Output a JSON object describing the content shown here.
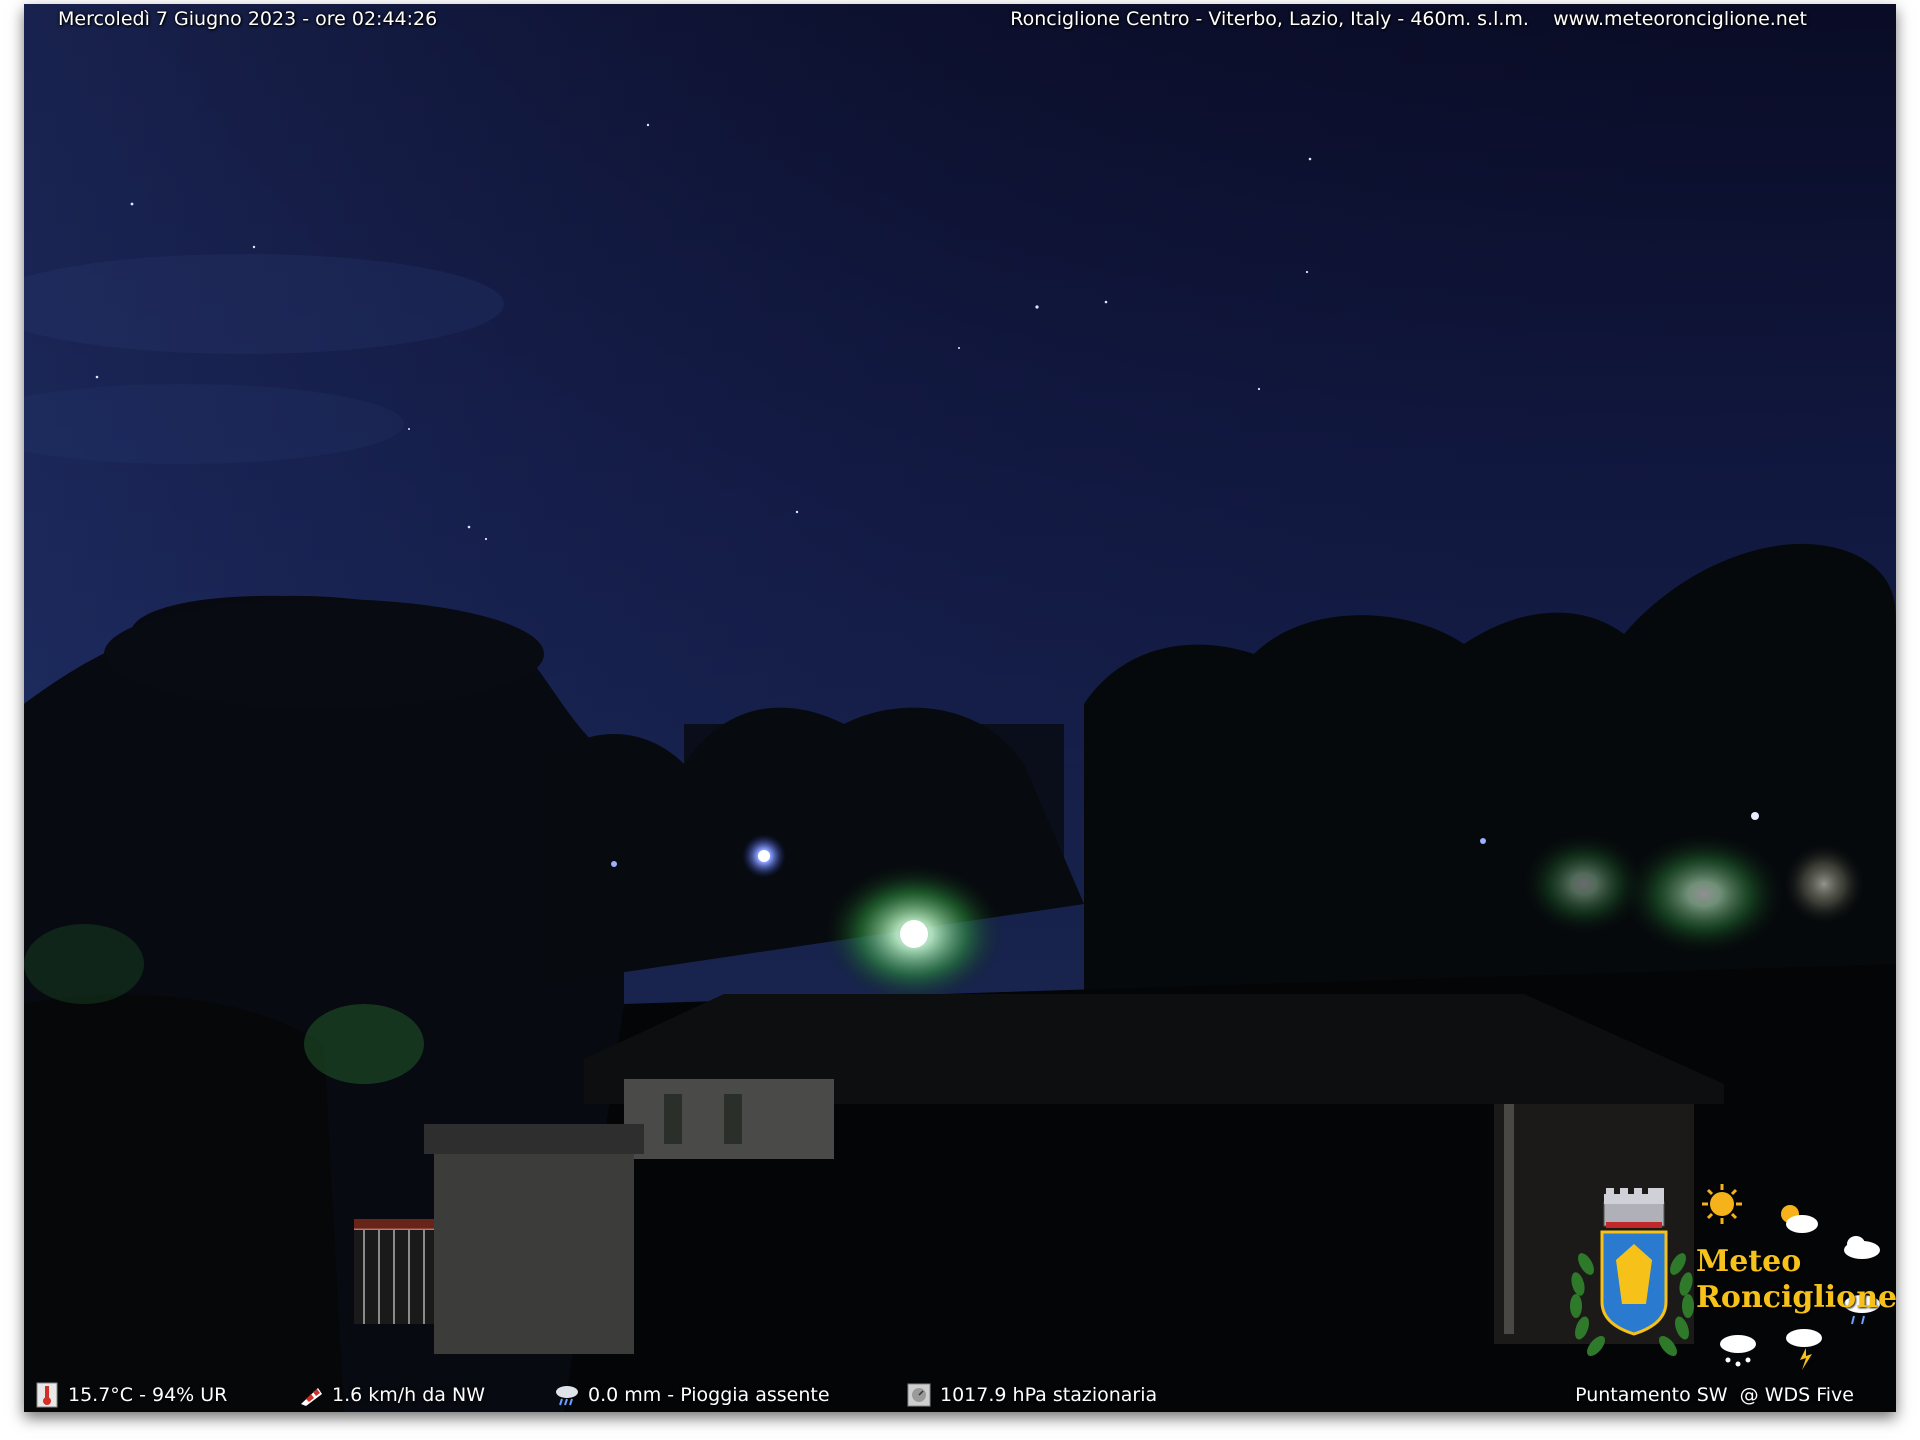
{
  "header": {
    "datetime": "Mercoledì 7 Giugno 2023 - ore 02:44:26",
    "location": "Ronciglione Centro - Viterbo, Lazio, Italy - 460m. s.l.m.    www.meteoronciglione.net"
  },
  "footer": {
    "temperature": "15.7°C - 94% UR",
    "wind": "1.6 km/h da NW",
    "rain": "0.0 mm - Pioggia assente",
    "pressure": "1017.9 hPa stazionaria",
    "pointing": "Puntamento SW  @ WDS Five"
  },
  "logo": {
    "line1": "Meteo",
    "line2": "Ronciglione"
  },
  "icons": {
    "temperature": "thermometer-icon",
    "wind": "windsock-icon",
    "rain": "rain-cloud-icon",
    "pressure": "barometer-icon"
  },
  "colors": {
    "sky_top": "#0b0e2a",
    "sky_bottom": "#1c2a5a",
    "logo_text": "#f6c21a"
  }
}
